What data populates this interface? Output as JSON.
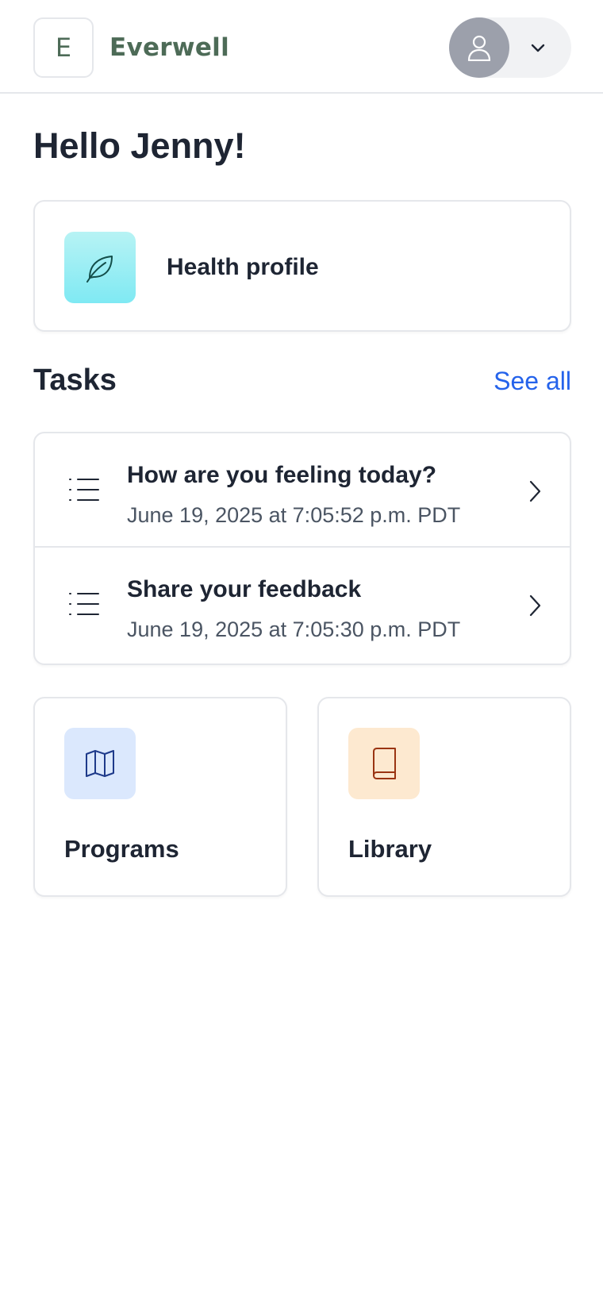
{
  "header": {
    "logo_letter": "E",
    "brand_name": "Everwell"
  },
  "greeting": "Hello Jenny!",
  "health_profile": {
    "label": "Health profile",
    "icon": "leaf-icon"
  },
  "tasks": {
    "heading": "Tasks",
    "see_all": "See all",
    "items": [
      {
        "title": "How are you feeling today?",
        "date": "June 19, 2025 at 7:05:52 p.m. PDT",
        "icon": "list-icon"
      },
      {
        "title": "Share your feedback",
        "date": "June 19, 2025 at 7:05:30 p.m. PDT",
        "icon": "list-icon"
      }
    ]
  },
  "tiles": [
    {
      "label": "Programs",
      "icon": "map-icon"
    },
    {
      "label": "Library",
      "icon": "book-icon"
    }
  ],
  "colors": {
    "brand": "#4d6b57",
    "link": "#2563eb",
    "text_primary": "#1e2533",
    "text_secondary": "#4b5563"
  }
}
